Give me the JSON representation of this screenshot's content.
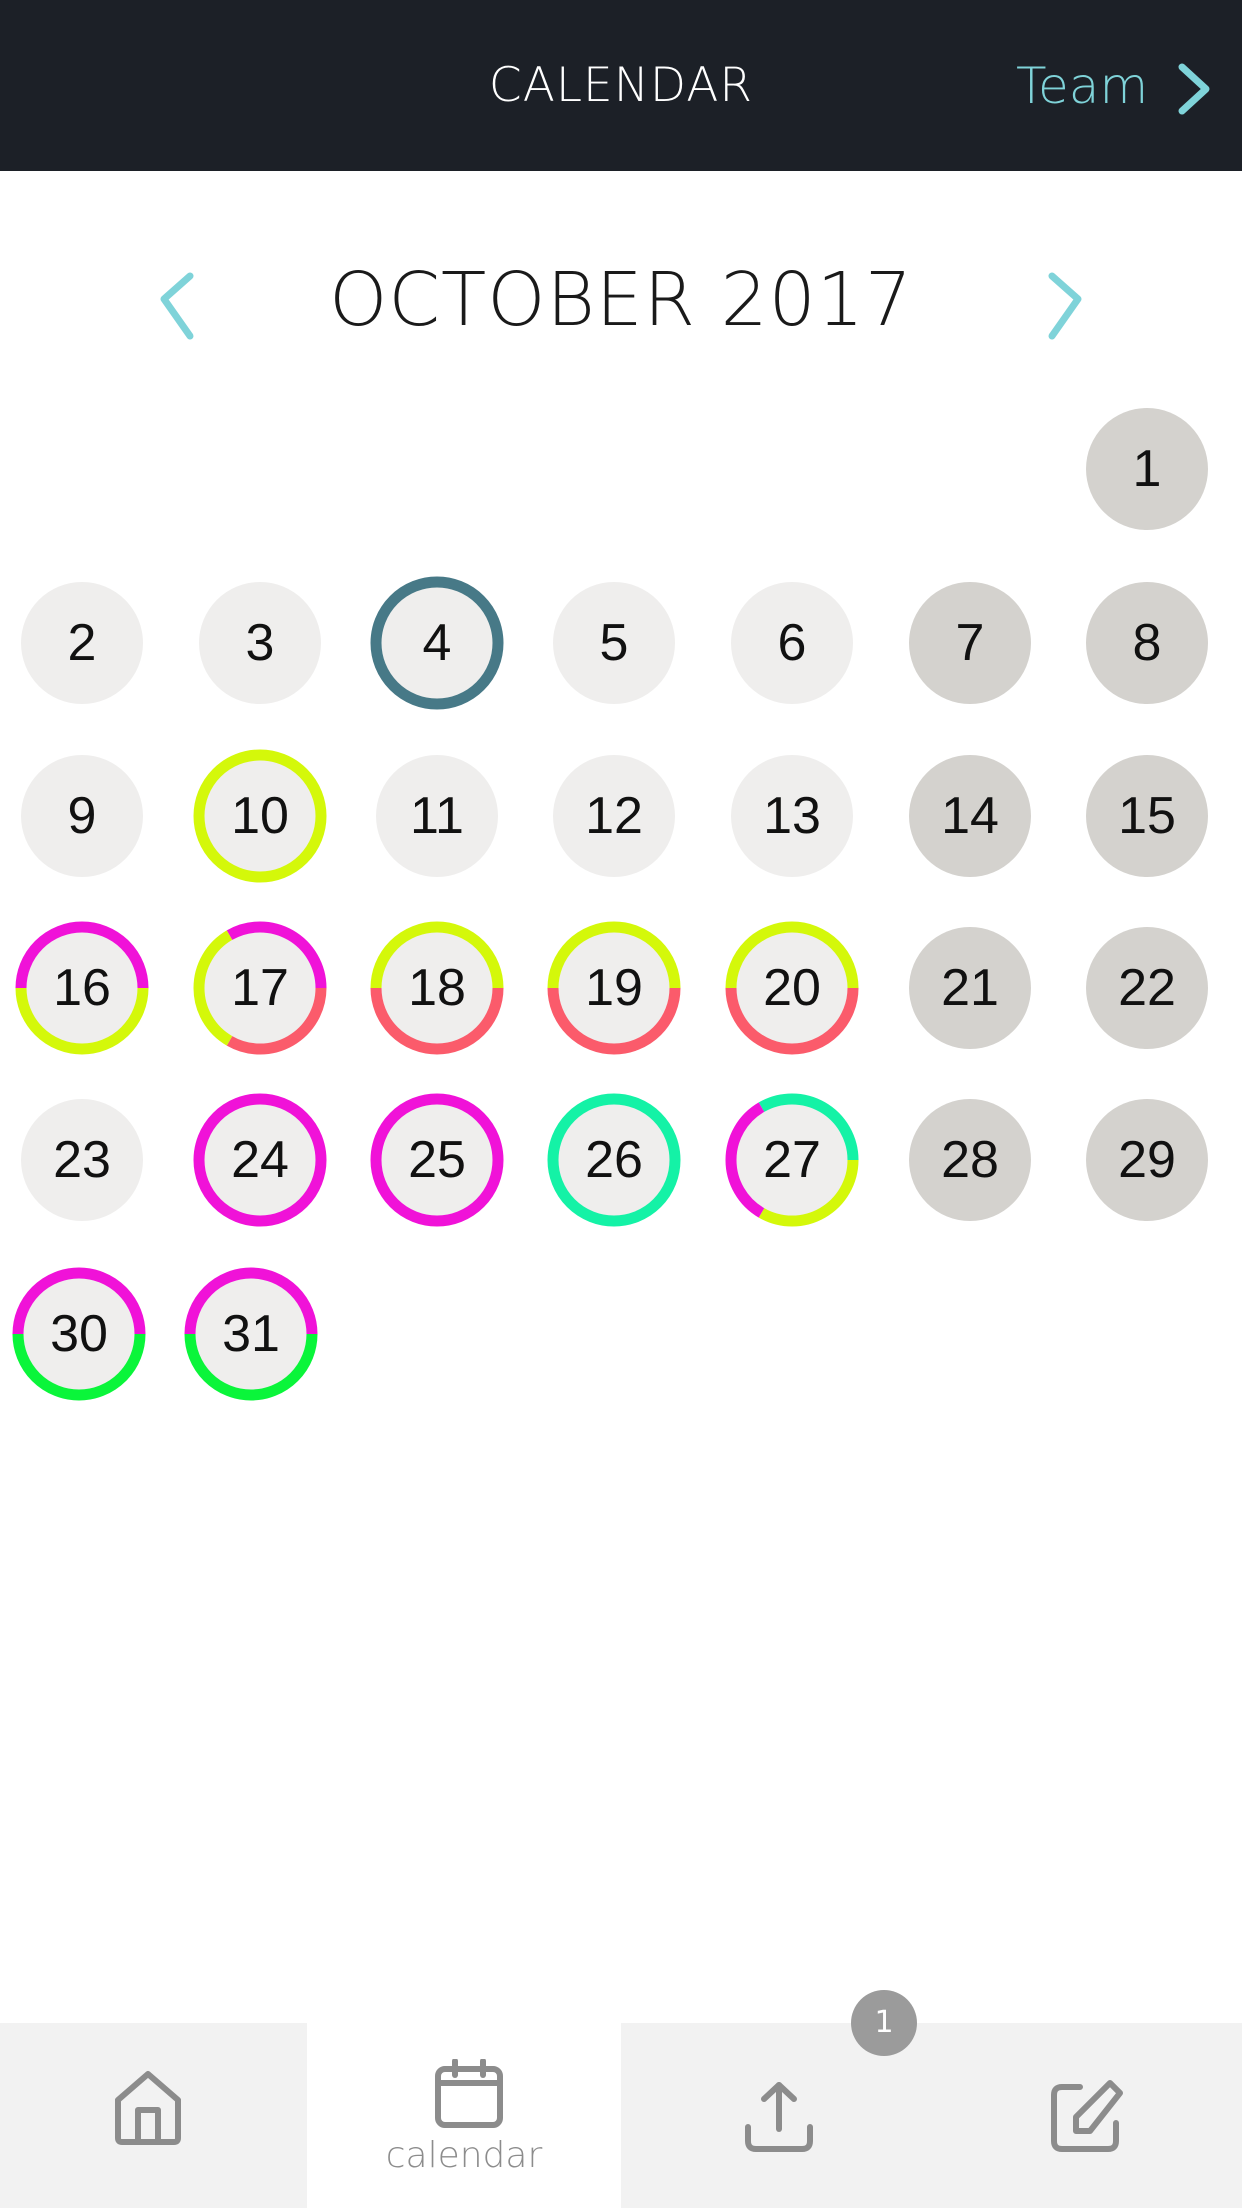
{
  "header": {
    "title": "CALENDAR",
    "team_link_label": "Team",
    "team_link_icon": "chevron-right-icon"
  },
  "month_nav": {
    "title": "OCTOBER 2017",
    "prev_icon": "chevron-left-icon",
    "next_icon": "chevron-right-icon"
  },
  "colors": {
    "header_bg": "#1c2027",
    "accent": "#7fd3d9",
    "weekday_fill": "#efeeed",
    "weekend_fill": "#d4d2ce",
    "today_ring": "#477987",
    "lime": "#d4f80a",
    "magenta": "#f012d8",
    "coral": "#fb5b6b",
    "mint": "#14f2a6",
    "green": "#0af53a",
    "icon_gray": "#8c8c8c",
    "badge_bg": "#9b9b9b"
  },
  "calendar": {
    "month": "October",
    "year": 2017,
    "first_weekday_column": 6,
    "today": 4,
    "days": [
      {
        "day": "1",
        "weekend": true,
        "rings": []
      },
      {
        "day": "2",
        "weekend": false,
        "rings": []
      },
      {
        "day": "3",
        "weekend": false,
        "rings": []
      },
      {
        "day": "4",
        "weekend": false,
        "today": true,
        "rings": [
          "today_ring"
        ]
      },
      {
        "day": "5",
        "weekend": false,
        "rings": []
      },
      {
        "day": "6",
        "weekend": false,
        "rings": []
      },
      {
        "day": "7",
        "weekend": true,
        "rings": []
      },
      {
        "day": "8",
        "weekend": true,
        "rings": []
      },
      {
        "day": "9",
        "weekend": false,
        "rings": []
      },
      {
        "day": "10",
        "weekend": false,
        "rings": [
          "lime"
        ]
      },
      {
        "day": "11",
        "weekend": false,
        "rings": []
      },
      {
        "day": "12",
        "weekend": false,
        "rings": []
      },
      {
        "day": "13",
        "weekend": false,
        "rings": []
      },
      {
        "day": "14",
        "weekend": true,
        "rings": []
      },
      {
        "day": "15",
        "weekend": true,
        "rings": []
      },
      {
        "day": "16",
        "weekend": false,
        "rings": [
          "magenta",
          "lime"
        ]
      },
      {
        "day": "17",
        "weekend": false,
        "rings": [
          "magenta",
          "coral",
          "lime"
        ]
      },
      {
        "day": "18",
        "weekend": false,
        "rings": [
          "lime",
          "coral"
        ]
      },
      {
        "day": "19",
        "weekend": false,
        "rings": [
          "lime",
          "coral"
        ]
      },
      {
        "day": "20",
        "weekend": false,
        "rings": [
          "lime",
          "coral"
        ]
      },
      {
        "day": "21",
        "weekend": true,
        "rings": []
      },
      {
        "day": "22",
        "weekend": true,
        "rings": []
      },
      {
        "day": "23",
        "weekend": false,
        "rings": []
      },
      {
        "day": "24",
        "weekend": false,
        "rings": [
          "magenta"
        ]
      },
      {
        "day": "25",
        "weekend": false,
        "rings": [
          "magenta"
        ]
      },
      {
        "day": "26",
        "weekend": false,
        "rings": [
          "mint"
        ]
      },
      {
        "day": "27",
        "weekend": false,
        "rings": [
          "mint",
          "lime",
          "magenta"
        ]
      },
      {
        "day": "28",
        "weekend": true,
        "rings": []
      },
      {
        "day": "29",
        "weekend": true,
        "rings": []
      },
      {
        "day": "30",
        "weekend": false,
        "rings": [
          "magenta",
          "green"
        ]
      },
      {
        "day": "31",
        "weekend": false,
        "rings": [
          "magenta",
          "green"
        ]
      }
    ]
  },
  "tabbar": {
    "tabs": [
      {
        "name": "home",
        "icon": "home-icon",
        "label": "",
        "active": false
      },
      {
        "name": "calendar",
        "icon": "calendar-icon",
        "label": "calendar",
        "active": true
      },
      {
        "name": "upload",
        "icon": "upload-icon",
        "label": "",
        "active": false,
        "badge": "1"
      },
      {
        "name": "edit",
        "icon": "edit-icon",
        "label": "",
        "active": false
      }
    ],
    "upload_badge": "1"
  }
}
